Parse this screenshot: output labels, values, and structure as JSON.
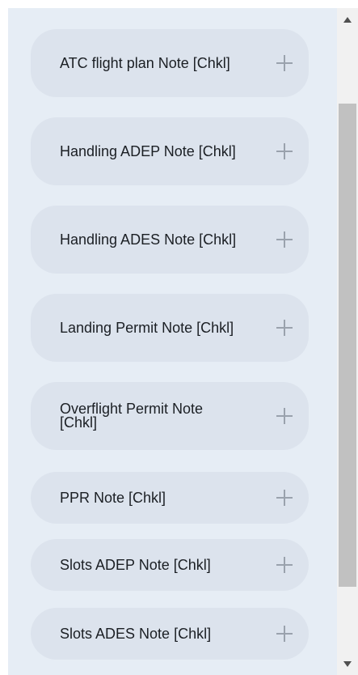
{
  "notes": {
    "items": [
      {
        "label": "ATC flight plan Note [Chkl]"
      },
      {
        "label": "Handling ADEP Note [Chkl]"
      },
      {
        "label": "Handling ADES Note [Chkl]"
      },
      {
        "label": "Landing Permit Note [Chkl]"
      },
      {
        "label": "Overflight Permit Note [Chkl]"
      },
      {
        "label": "PPR Note [Chkl]"
      },
      {
        "label": "Slots ADEP Note [Chkl]"
      },
      {
        "label": "Slots ADES Note [Chkl]"
      }
    ]
  },
  "icons": {
    "add": "plus-icon",
    "scroll_up": "triangle-up-icon",
    "scroll_down": "triangle-down-icon"
  },
  "colors": {
    "panel_background": "#e6edf5",
    "item_background": "#dce3ed",
    "plus_icon": "#9aa2ad",
    "text": "#1b1f24",
    "scroll_thumb": "#c1c1c1"
  }
}
